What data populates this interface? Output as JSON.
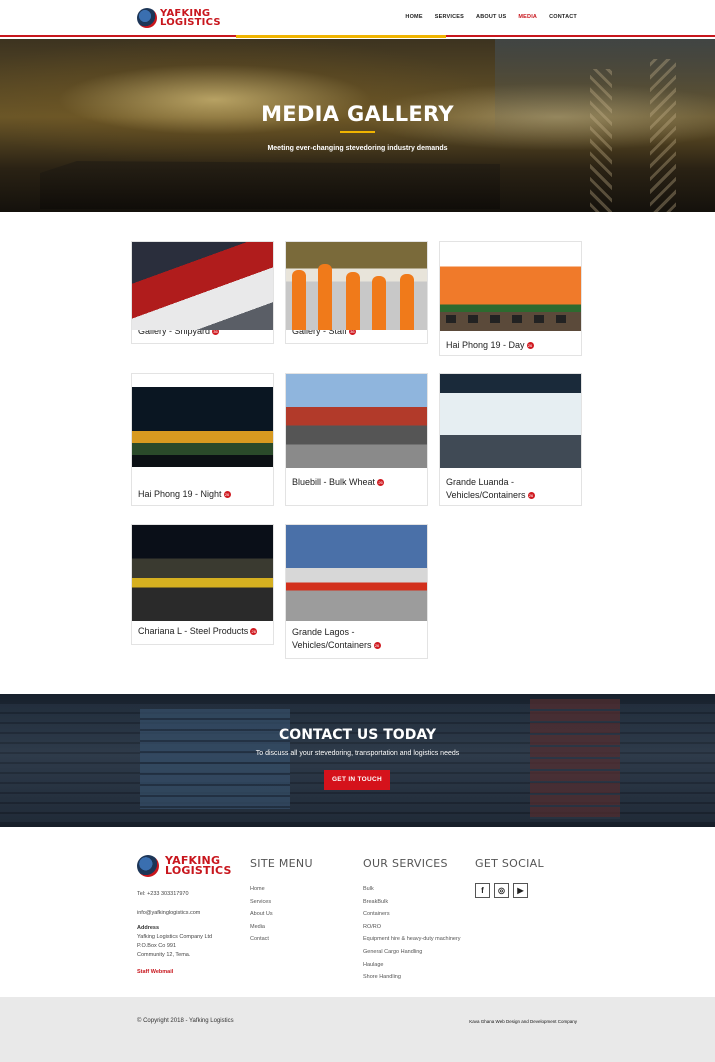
{
  "header": {
    "logo_line1": "YAFKING",
    "logo_line2": "LOGISTICS",
    "nav": [
      "HOME",
      "SERVICES",
      "ABOUT US",
      "MEDIA",
      "CONTACT"
    ],
    "active_nav": "MEDIA"
  },
  "hero": {
    "title": "MEDIA GALLERY",
    "subtitle": "Meeting ever-changing stevedoring industry demands"
  },
  "gallery": [
    {
      "caption": "Gallery - Shipyard",
      "badge": "36"
    },
    {
      "caption": "Gallery - Staff",
      "badge": "36"
    },
    {
      "caption": "Hai Phong 19 - Day",
      "badge": "26"
    },
    {
      "caption": "Hai Phong 19 - Night",
      "badge": "26"
    },
    {
      "caption": "Bluebill - Bulk Wheat",
      "badge": "26"
    },
    {
      "caption": "Grande Luanda - Vehicles/Containers",
      "badge": "26"
    },
    {
      "caption": "Chariana L - Steel Products",
      "badge": "26"
    },
    {
      "caption": "Grande Lagos - Vehicles/Containers",
      "badge": "26"
    }
  ],
  "cta": {
    "title": "CONTACT US TODAY",
    "subtitle": "To discuss all your stevedoring, transportation and logistics needs",
    "button": "GET IN TOUCH"
  },
  "footer": {
    "tel": "Tel: +233 303317970",
    "email": "info@yafkinglogistics.com",
    "address_label": "Address",
    "address_lines": [
      "Yafking Logistics Company Ltd",
      "P.O.Box Co 991",
      "Community 12, Tema."
    ],
    "webmail": "Staff Webmail",
    "site_menu_title": "SITE MENU",
    "site_menu": [
      "Home",
      "Services",
      "About Us",
      "Media",
      "Contact"
    ],
    "services_title": "OUR SERVICES",
    "services": [
      "Bulk",
      "BreakBulk",
      "Containers",
      "RO/RO",
      "Equipment hire & heavy-duty machinery",
      "General Cargo Handling",
      "Haulage",
      "Shore Handling"
    ],
    "social_title": "GET SOCIAL",
    "social_icons": [
      "f",
      "◎",
      "▶"
    ]
  },
  "bottom": {
    "copyright": "© Copyright 2018 - Yafking Logistics",
    "credit": "Kava Ghana Web Design and Development Company"
  }
}
